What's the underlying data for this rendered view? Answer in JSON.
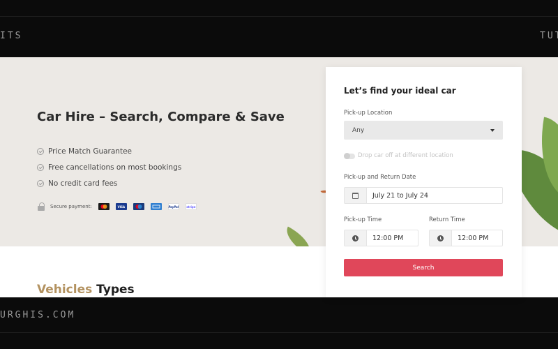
{
  "frame": {
    "top_left_text": "ITS",
    "top_right_text": "TUT",
    "bottom_left_text": "URGHIS.COM"
  },
  "hero": {
    "title": "Car Hire – Search, Compare & Save",
    "features": [
      "Price Match Guarantee",
      "Free cancellations on most bookings",
      "No credit card fees"
    ],
    "secure_payment_label": "Secure payment:",
    "payment_methods": [
      {
        "name": "mastercard",
        "icon": "mastercard-icon",
        "color": "#1a1a1a",
        "text": ""
      },
      {
        "name": "visa",
        "icon": "visa-icon",
        "color": "#1a3b8f",
        "text": "VISA"
      },
      {
        "name": "maestro",
        "icon": "maestro-icon",
        "color": "#1b3a7a",
        "text": ""
      },
      {
        "name": "american-express",
        "icon": "amex-icon",
        "color": "#2f7fd0",
        "text": ""
      },
      {
        "name": "paypal",
        "icon": "paypal-icon",
        "color": "#ffffff",
        "text": "PayPal"
      },
      {
        "name": "stripe",
        "icon": "stripe-icon",
        "color": "#ffffff",
        "text": "stripe"
      }
    ]
  },
  "section": {
    "accent_word": "Vehicles",
    "rest": " Types"
  },
  "search_form": {
    "title": "Let’s find your ideal car",
    "pickup_location_label": "Pick-up Location",
    "pickup_location_value": "Any",
    "drop_off_toggle_label": "Drop car off at different location",
    "drop_off_toggle_on": false,
    "date_label": "Pick-up and Return Date",
    "date_value": "July 21 to July 24",
    "pickup_time_label": "Pick-up Time",
    "pickup_time_value": "12:00 PM",
    "return_time_label": "Return Time",
    "return_time_value": "12:00 PM",
    "search_button": "Search"
  },
  "colors": {
    "accent_gold": "#b39260",
    "search_button": "#e0475a",
    "hero_background": "#ece9e5"
  }
}
